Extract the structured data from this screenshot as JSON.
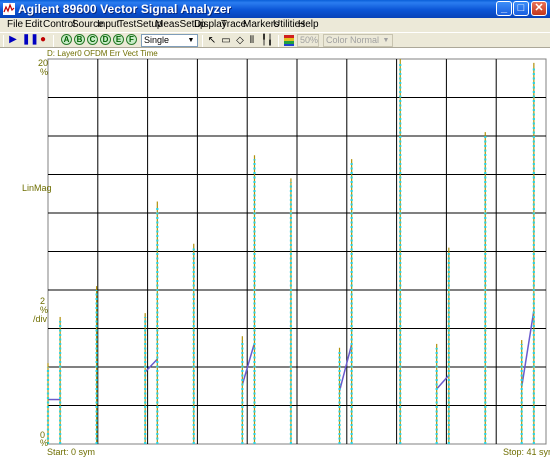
{
  "window": {
    "title": "Agilent 89600 Vector Signal Analyzer",
    "minimize_label": "_",
    "maximize_label": "□",
    "close_label": "✕"
  },
  "menu": [
    "File",
    "Edit",
    "Control",
    "Source",
    "Input",
    "TestSetup",
    "MeasSetup",
    "Display",
    "Trace",
    "Markers",
    "Utilities",
    "Help"
  ],
  "toolbar": {
    "trace_buttons": [
      "A",
      "B",
      "C",
      "D",
      "E",
      "F"
    ],
    "sweep_mode": "Single",
    "brightness": "50%",
    "color_mode": "Color Normal",
    "icons": [
      "play-icon",
      "pause-icon",
      "record-icon",
      "pointer-icon",
      "zoom-box-icon",
      "marker-icon",
      "grid-icon",
      "marker-peak-icon",
      "color-map-icon"
    ]
  },
  "trace": {
    "title": "D: Layer0 OFDM Err Vect Time",
    "y_top_value": "20",
    "y_top_unit": "%",
    "y_scale_name": "LinMag",
    "y_div_value": "2",
    "y_div_unit": "%",
    "y_div_label": "/div",
    "y_bottom_value": "0",
    "y_bottom_unit": "%",
    "start_label": "Start: 0  sym",
    "stop_label": "Stop: 41  sym",
    "colors": {
      "grid": "#000000",
      "frame": "#808080",
      "stem": "#b0900a",
      "dot": "#29d3e0",
      "line": "#6a5acd"
    }
  },
  "chart_data": {
    "type": "scatter",
    "title": "D: Layer0 OFDM Err Vect Time",
    "xlabel": "sym",
    "ylabel": "LinMag",
    "xlim": [
      0,
      41
    ],
    "ylim": [
      0,
      20
    ],
    "y_units": "%",
    "series": [
      {
        "symbols": [
          0,
          1,
          4,
          8,
          9,
          12,
          16,
          17,
          20,
          24,
          25,
          29,
          32,
          33,
          36,
          39,
          40
        ],
        "values": [
          4.2,
          6.6,
          8.2,
          6.8,
          12.6,
          10.4,
          5.6,
          15.0,
          13.8,
          5.0,
          14.8,
          20.0,
          5.2,
          10.2,
          16.2,
          5.4,
          19.8
        ]
      }
    ]
  }
}
